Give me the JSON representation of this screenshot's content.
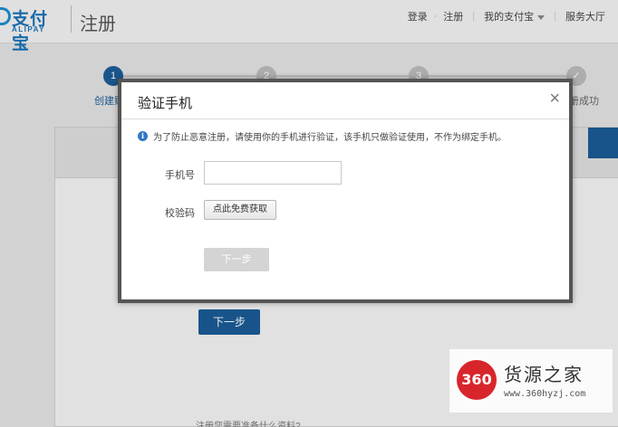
{
  "header": {
    "logo_cn": "支付宝",
    "logo_en": "ALIPAY",
    "page_title": "注册",
    "nav": {
      "login": "登录",
      "separator": "·",
      "register": "注册",
      "my_alipay": "我的支付宝",
      "service_hall": "服务大厅"
    }
  },
  "steps": [
    {
      "number": "1",
      "label": "创建账"
    },
    {
      "number": "2",
      "label": ""
    },
    {
      "number": "3",
      "label": ""
    },
    {
      "number": "✓",
      "label": "册成功"
    }
  ],
  "background": {
    "next_button": "下一步",
    "footer_text": "注册您需要准备什么资料?"
  },
  "modal": {
    "title": "验证手机",
    "close": "×",
    "notice": "为了防止恶意注册，请使用你的手机进行验证，该手机只做验证使用，不作为绑定手机。",
    "phone_label": "手机号",
    "phone_value": "",
    "code_label": "校验码",
    "code_button": "点此免费获取",
    "next_button": "下一步"
  },
  "watermark": {
    "badge": "360",
    "text": "货源之家",
    "url": "www.360hyzj.com"
  },
  "colors": {
    "brand_blue": "#1b5c96",
    "alipay_blue": "#1a73b8",
    "watermark_red": "#d8252b"
  }
}
